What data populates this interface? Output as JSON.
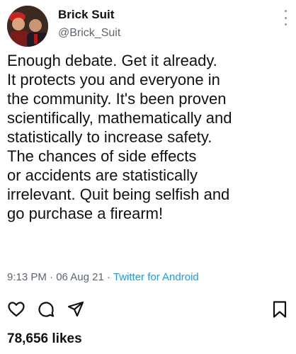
{
  "author": {
    "display_name": "Brick Suit",
    "handle": "@Brick_Suit",
    "avatar_icon": "profile-photo"
  },
  "tweet": {
    "lines": [
      "Enough debate. Get it already.",
      "It protects you and everyone in",
      "the community. It's been proven",
      "scientifically, mathematically and",
      "statistically to increase safety.",
      "The chances of side effects",
      "or accidents are statistically",
      "irrelevant. Quit being selfish and",
      "go purchase a firearm!"
    ],
    "time": "9:13 PM",
    "date": "06 Aug 21",
    "separator": " · ",
    "client": "Twitter for Android"
  },
  "actions": {
    "icons": [
      "heart-icon",
      "comment-icon",
      "share-icon",
      "bookmark-icon"
    ]
  },
  "stats": {
    "likes": "78,656 likes"
  },
  "colors": {
    "text": "#111111",
    "secondary": "#5b6670",
    "accent": "#1d9bf0"
  }
}
